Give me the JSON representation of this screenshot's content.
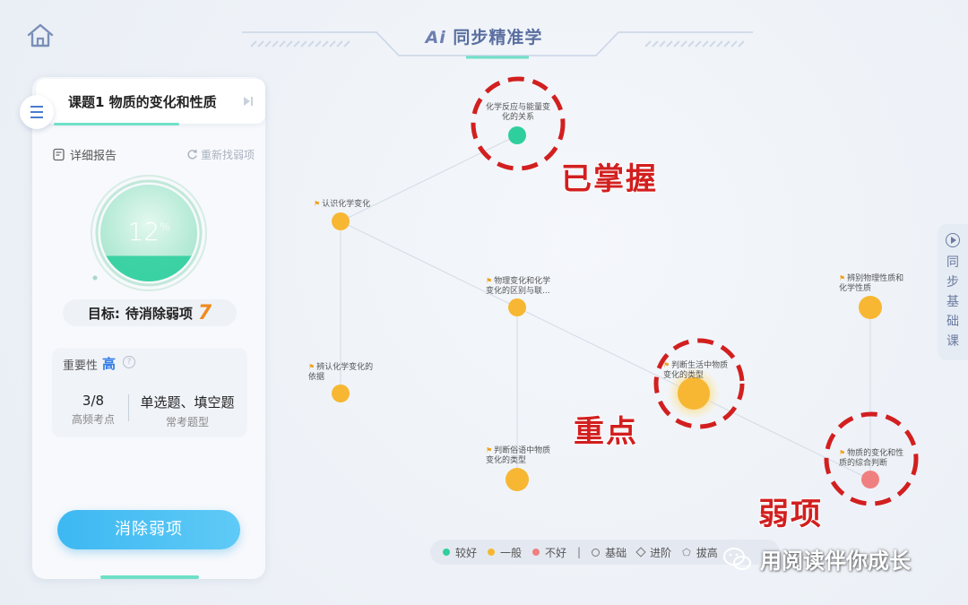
{
  "header": {
    "title_ai": "Ai",
    "title_rest": "同步精准学"
  },
  "lesson": {
    "title": "课题1 物质的变化和性质"
  },
  "report": {
    "detail_label": "详细报告",
    "refind_label": "重新找弱项"
  },
  "gauge": {
    "percent": "12",
    "unit": "%",
    "progress": 0.12
  },
  "target": {
    "label": "目标:",
    "text": "待消除弱项",
    "count": "7"
  },
  "importance": {
    "label": "重要性",
    "value": "高",
    "help": "?",
    "stats": [
      {
        "value": "3/8",
        "sub": "高频考点"
      },
      {
        "value": "单选题、填空题",
        "sub": "常考题型"
      }
    ]
  },
  "clear_button": "消除弱项",
  "nodes": [
    {
      "label": "化学反应与能量变化的关系",
      "status": "good"
    },
    {
      "label": "认识化学变化",
      "status": "average"
    },
    {
      "label": "物理变化和化学变化的区别与联...",
      "status": "average"
    },
    {
      "label": "辨认化学变化的依据",
      "status": "average"
    },
    {
      "label": "判断生活中物质变化的类型",
      "status": "average"
    },
    {
      "label": "判断俗语中物质变化的类型",
      "status": "average"
    },
    {
      "label": "辨别物理性质和化学性质",
      "status": "average"
    },
    {
      "label": "物质的变化和性质的综合判断",
      "status": "bad"
    }
  ],
  "annotations": {
    "mastered": "已掌握",
    "key_point": "重点",
    "weak": "弱项"
  },
  "side_tab": {
    "chars": [
      "同",
      "步",
      "基",
      "础",
      "课"
    ]
  },
  "legend": {
    "good": "较好",
    "average": "一般",
    "bad": "不好",
    "sep": "|",
    "basic": "基础",
    "advanced": "进阶",
    "extend": "拔高"
  },
  "colors": {
    "good": "#2fcf9d",
    "average": "#f7b733",
    "bad": "#f08080",
    "accent": "#3db8f2",
    "annotation": "#d21f1f"
  },
  "watermark": "用阅读伴你成长"
}
